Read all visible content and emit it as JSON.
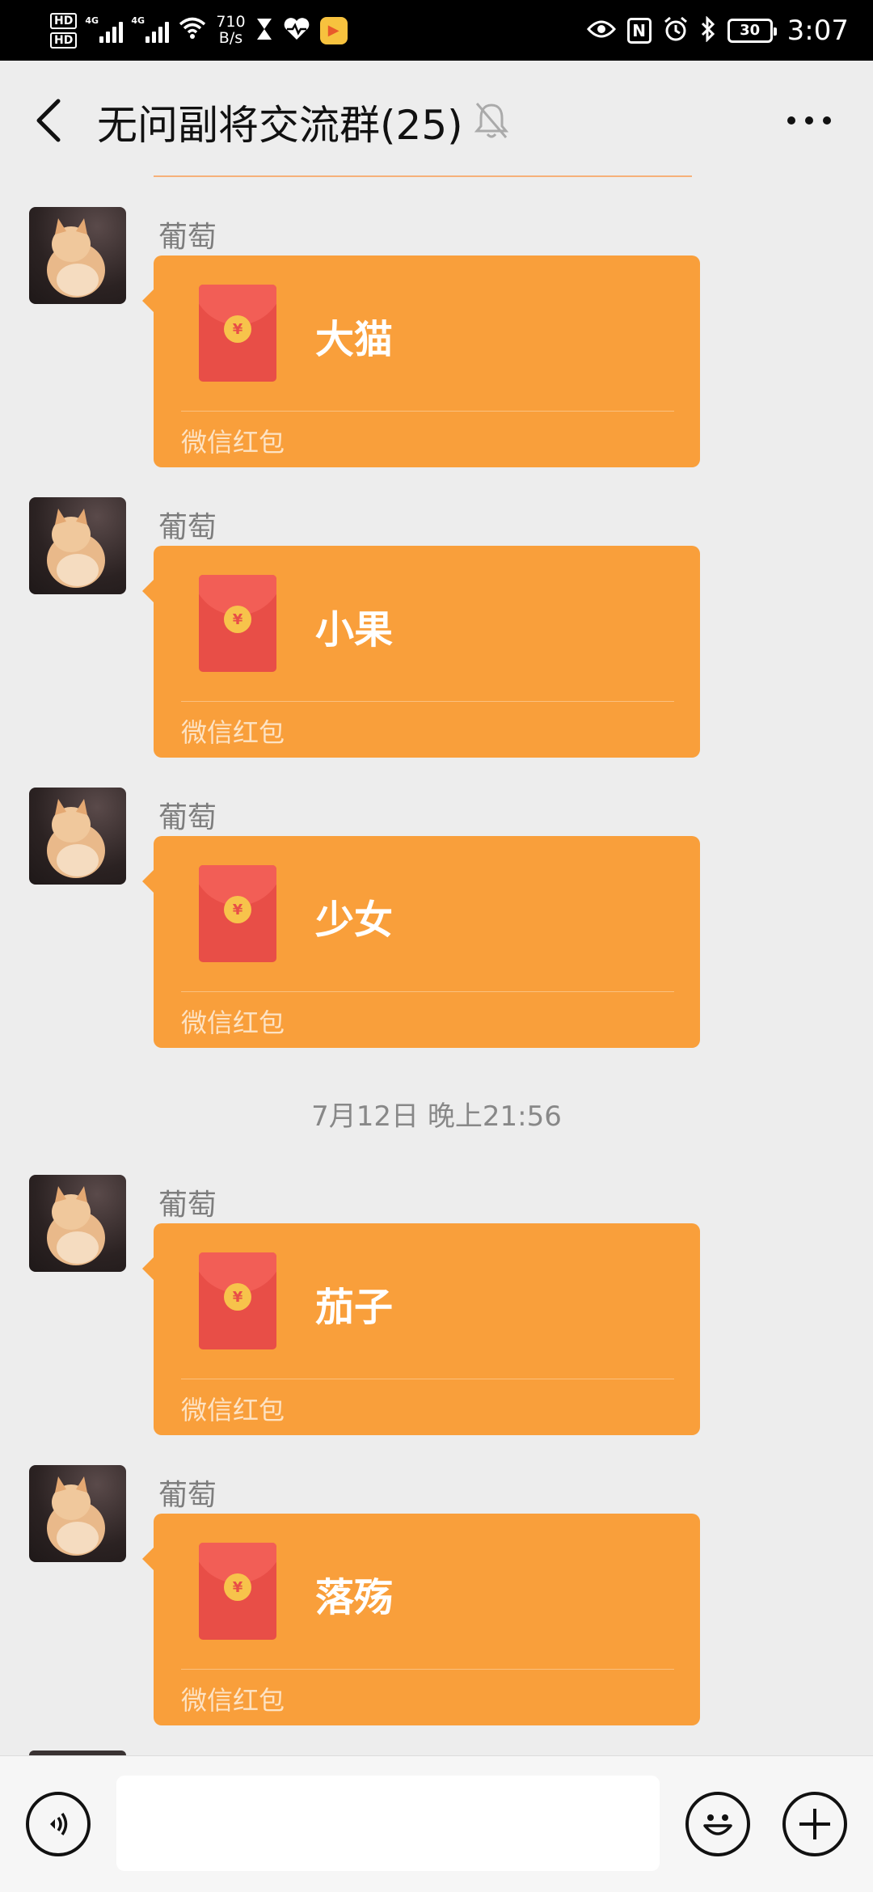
{
  "status_bar": {
    "hd1": "HD",
    "hd2": "HD",
    "sim1_net": "4G",
    "sim2_net": "4G",
    "net_speed_value": "710",
    "net_speed_unit": "B/s",
    "battery": "30",
    "time": "3:07",
    "nfc": "N",
    "icons": [
      "hd-icon",
      "signal-icon",
      "signal-icon",
      "wifi-icon",
      "hourglass-icon",
      "health-icon",
      "app-icon",
      "eye-icon",
      "nfc-icon",
      "alarm-icon",
      "bluetooth-icon",
      "battery-icon"
    ]
  },
  "header": {
    "title": "无问副将交流群(25)",
    "icons": [
      "back-icon",
      "mute-bell-icon",
      "more-icon"
    ]
  },
  "messages": [
    {
      "sender": "葡萄",
      "redpacket_text": "大猫",
      "redpacket_label": "微信红包"
    },
    {
      "sender": "葡萄",
      "redpacket_text": "小果",
      "redpacket_label": "微信红包"
    },
    {
      "sender": "葡萄",
      "redpacket_text": "少女",
      "redpacket_label": "微信红包"
    },
    {
      "sender": "葡萄",
      "redpacket_text": "茄子",
      "redpacket_label": "微信红包"
    },
    {
      "sender": "葡萄",
      "redpacket_text": "落殇",
      "redpacket_label": "微信红包"
    }
  ],
  "timestamp": "7月12日 晚上21:56",
  "input_bar": {
    "value": "",
    "icons": [
      "voice-icon",
      "emoji-icon",
      "plus-icon"
    ]
  },
  "colors": {
    "background": "#ededed",
    "redpacket": "#f99f3b",
    "envelope": "#e84e47",
    "coin": "#f7c34b",
    "status_bar": "#000000"
  }
}
